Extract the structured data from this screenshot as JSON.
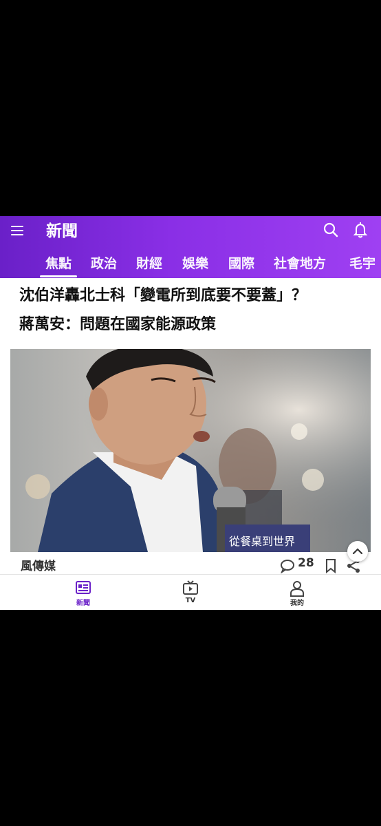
{
  "header": {
    "title": "新聞",
    "tabs": [
      {
        "label": "焦點",
        "active": true
      },
      {
        "label": "政治"
      },
      {
        "label": "財經"
      },
      {
        "label": "娛樂"
      },
      {
        "label": "國際"
      },
      {
        "label": "社會地方"
      },
      {
        "label": "毛宇"
      }
    ]
  },
  "article": {
    "headline_line1": "沈伯洋轟北士科「變電所到底要不要蓋」？",
    "headline_line2": "蔣萬安：問題在國家能源政策",
    "source": "風傳媒",
    "comment_count": "28",
    "mic_text": "從餐桌到世界"
  },
  "bottom_nav": {
    "news": "新聞",
    "tv": "TV",
    "me": "我的"
  },
  "colors": {
    "accent": "#6a20c8",
    "header_gradient_end": "#9f40f2"
  }
}
